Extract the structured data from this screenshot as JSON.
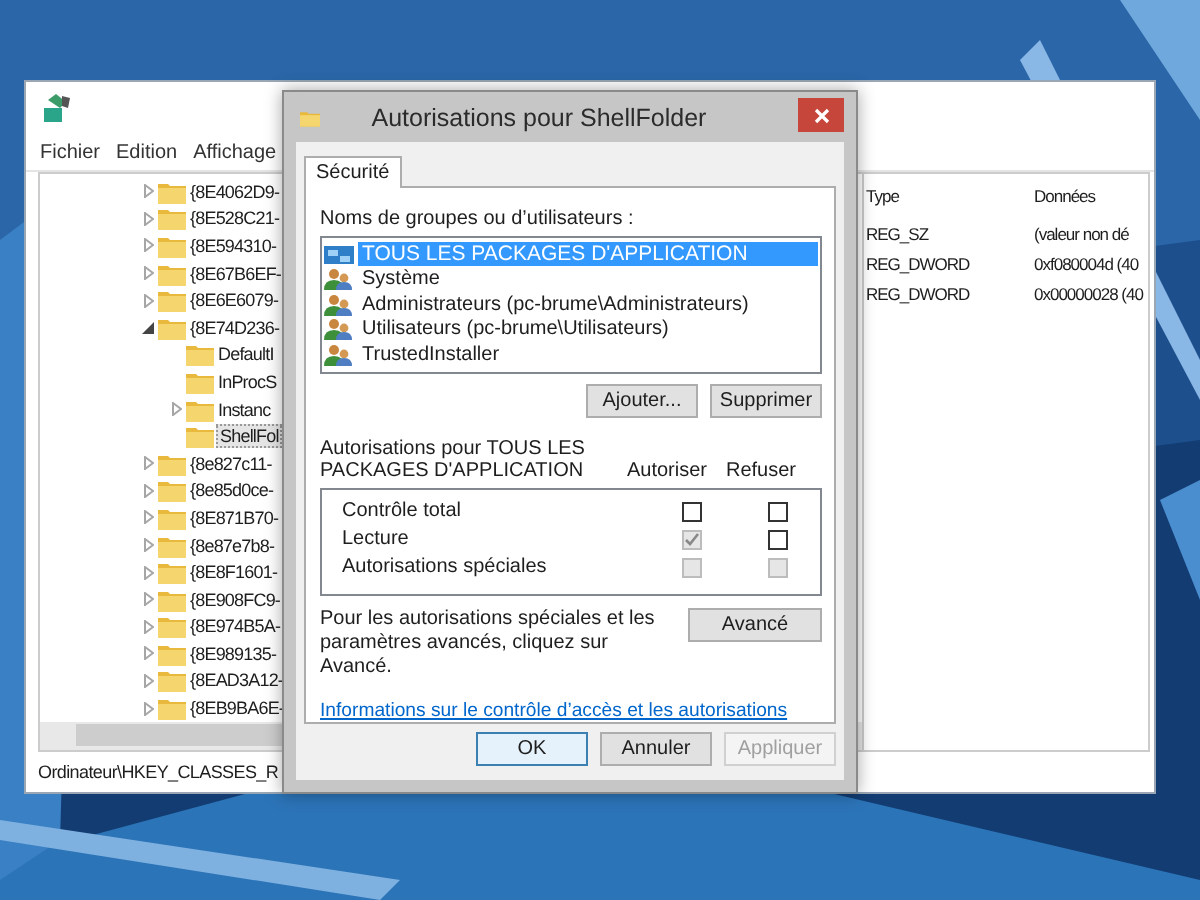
{
  "registry_window": {
    "menu": [
      "Fichier",
      "Edition",
      "Affichage"
    ],
    "tree": [
      {
        "label": "{8E4062D9-",
        "expandable": true,
        "expanded": false,
        "selected": false
      },
      {
        "label": "{8E528C21-",
        "expandable": true,
        "expanded": false,
        "selected": false
      },
      {
        "label": "{8E594310-",
        "expandable": true,
        "expanded": false,
        "selected": false
      },
      {
        "label": "{8E67B6EF-",
        "expandable": true,
        "expanded": false,
        "selected": false
      },
      {
        "label": "{8E6E6079-",
        "expandable": true,
        "expanded": false,
        "selected": false
      },
      {
        "label": "{8E74D236-",
        "expandable": true,
        "expanded": true,
        "selected": false,
        "children": [
          {
            "label": "DefaultI",
            "expandable": false,
            "selected": false
          },
          {
            "label": "InProcS",
            "expandable": false,
            "selected": false
          },
          {
            "label": "Instanc",
            "expandable": true,
            "expanded": false,
            "selected": false
          },
          {
            "label": "ShellFol",
            "expandable": false,
            "selected": true
          }
        ]
      },
      {
        "label": "{8e827c11-",
        "expandable": true,
        "expanded": false,
        "selected": false
      },
      {
        "label": "{8e85d0ce-",
        "expandable": true,
        "expanded": false,
        "selected": false
      },
      {
        "label": "{8E871B70-",
        "expandable": true,
        "expanded": false,
        "selected": false
      },
      {
        "label": "{8e87e7b8-",
        "expandable": true,
        "expanded": false,
        "selected": false
      },
      {
        "label": "{8E8F1601-",
        "expandable": true,
        "expanded": false,
        "selected": false
      },
      {
        "label": "{8E908FC9-",
        "expandable": true,
        "expanded": false,
        "selected": false
      },
      {
        "label": "{8E974B5A-",
        "expandable": true,
        "expanded": false,
        "selected": false
      },
      {
        "label": "{8E989135-",
        "expandable": true,
        "expanded": false,
        "selected": false
      },
      {
        "label": "{8EAD3A12-",
        "expandable": true,
        "expanded": false,
        "selected": false
      },
      {
        "label": "{8EB9BA6E-",
        "expandable": true,
        "expanded": false,
        "selected": false
      }
    ],
    "table": {
      "columns": [
        "Type",
        "Données"
      ],
      "rows": [
        [
          "REG_SZ",
          "(valeur non dé"
        ],
        [
          "REG_DWORD",
          "0xf080004d (40"
        ],
        [
          "REG_DWORD",
          "0x00000028 (40"
        ]
      ]
    },
    "status_bar": "Ordinateur\\HKEY_CLASSES_R"
  },
  "dialog": {
    "title": "Autorisations pour ShellFolder",
    "tabs": [
      {
        "label": "Sécurité",
        "selected": true
      }
    ],
    "principals_label": "Noms de groupes ou d’utilisateurs :",
    "principals": [
      {
        "name": "TOUS LES PACKAGES D'APPLICATION",
        "kind": "package",
        "selected": true
      },
      {
        "name": "Système",
        "kind": "users",
        "selected": false
      },
      {
        "name": "Administrateurs (pc-brume\\Administrateurs)",
        "kind": "users",
        "selected": false
      },
      {
        "name": "Utilisateurs (pc-brume\\Utilisateurs)",
        "kind": "users",
        "selected": false
      },
      {
        "name": "TrustedInstaller",
        "kind": "users",
        "selected": false
      }
    ],
    "principal_buttons": [
      "Ajouter...",
      "Supprimer"
    ],
    "permissions_label": "Autorisations pour TOUS LES PACKAGES D'APPLICATION",
    "columns": [
      "Autoriser",
      "Refuser"
    ],
    "permissions": [
      {
        "name": "Contrôle total",
        "allow": {
          "checked": false,
          "disabled": false
        },
        "deny": {
          "checked": false,
          "disabled": false
        }
      },
      {
        "name": "Lecture",
        "allow": {
          "checked": true,
          "disabled": true
        },
        "deny": {
          "checked": false,
          "disabled": false
        }
      },
      {
        "name": "Autorisations spéciales",
        "allow": {
          "checked": false,
          "disabled": true
        },
        "deny": {
          "checked": false,
          "disabled": true
        }
      }
    ],
    "advanced_text": "Pour les autorisations spéciales et les paramètres avancés, cliquez sur Avancé.",
    "advanced_button": "Avancé",
    "link": "Informations sur le contrôle d’accès et les autorisations",
    "buttons": [
      {
        "label": "OK",
        "default": true,
        "disabled": false
      },
      {
        "label": "Annuler",
        "default": false,
        "disabled": false
      },
      {
        "label": "Appliquer",
        "default": false,
        "disabled": true
      }
    ]
  }
}
